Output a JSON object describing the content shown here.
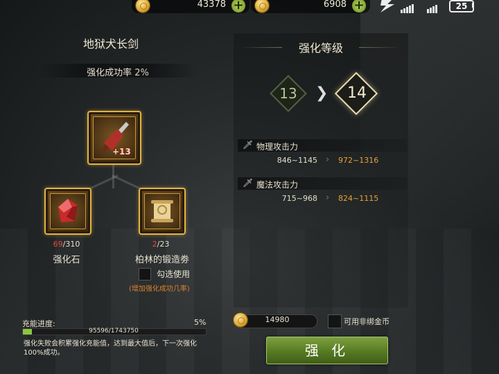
{
  "topbar": {
    "currency1": "43378",
    "currency2": "6908",
    "battery": "25"
  },
  "item": {
    "name": "地狱犬长剑",
    "rate_label": "强化成功率",
    "rate_value": "2%",
    "plus_level": "+13"
  },
  "materials": [
    {
      "name": "强化石",
      "have": "69",
      "need": "/310",
      "icon": "red-gem-icon"
    },
    {
      "name": "柏林的锻造劵",
      "have": "2",
      "need": "/23",
      "icon": "scroll-icon"
    }
  ],
  "check": {
    "label": "勾选使用",
    "note": "(增加强化成功几率)"
  },
  "enhance_level": {
    "title": "强化等级",
    "from": "13",
    "to": "14"
  },
  "stats": [
    {
      "name": "物理攻击力",
      "old": "846~1145",
      "new": "972~1316"
    },
    {
      "name": "魔法攻击力",
      "old": "715~968",
      "new": "824~1115"
    }
  ],
  "charge": {
    "label": "充能进度:",
    "percent": "5%",
    "fraction": 0.05,
    "count": "95596/1743750",
    "desc": "强化失败会积累强化充能值，达到最大值后，下一次强化100%成功。"
  },
  "gold": {
    "value": "14980",
    "bind_label": "可用非绑金币"
  },
  "button": {
    "label": "强 化"
  },
  "colors": {
    "accent_gold": "#e0b447",
    "stat_new": "#e8a13a",
    "button_green": "#567a22",
    "progress_green": "#8cc640",
    "material_short": "#e74c3c"
  }
}
